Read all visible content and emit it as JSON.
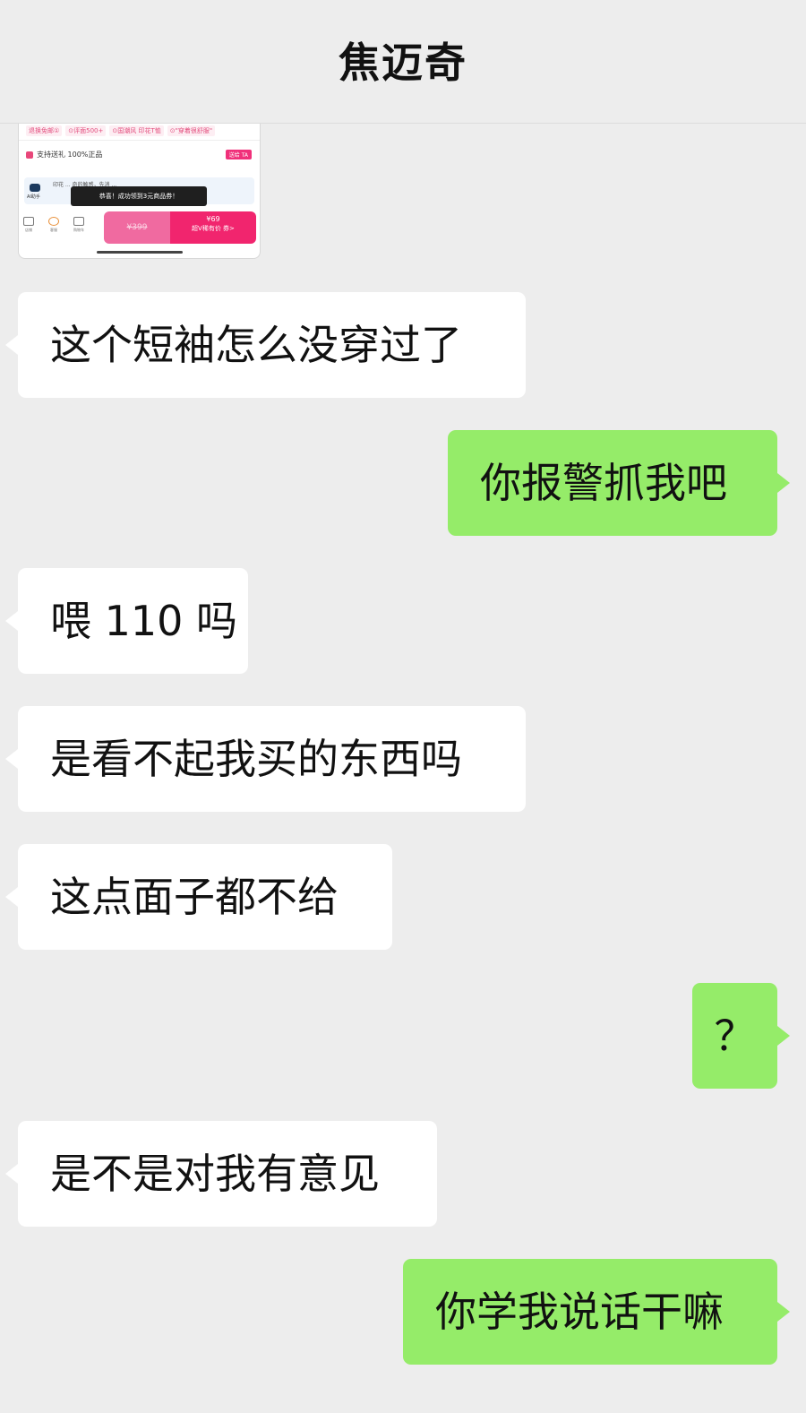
{
  "header": {
    "title": "焦迈奇"
  },
  "thumbnail": {
    "tags": [
      "退换免邮①",
      "⊙评面500+",
      "⊙国潮风 印花T恤",
      "⊙\"穿着很舒服\""
    ],
    "support_text": "支持送礼  100%正品",
    "send_label": "送给 TA",
    "ai_label": "AI助手",
    "ai_text": "印花 ... 奇的触感，先消 ...",
    "toast": "恭喜！成功领到3元商品券！",
    "bottom_icons": [
      "店铺",
      "客服",
      "购物车"
    ],
    "original_price": "¥399",
    "sale_price": "¥69",
    "sale_sub": "超V稀有价 券>"
  },
  "messages": [
    {
      "side": "left",
      "text": "这个短袖怎么没穿过了"
    },
    {
      "side": "right",
      "text": "你报警抓我吧"
    },
    {
      "side": "left",
      "text": "喂 110 吗"
    },
    {
      "side": "left",
      "text": "是看不起我买的东西吗"
    },
    {
      "side": "left",
      "text": "这点面子都不给"
    },
    {
      "side": "right",
      "text": "？"
    },
    {
      "side": "left",
      "text": "是不是对我有意见"
    },
    {
      "side": "right",
      "text": "你学我说话干嘛"
    }
  ],
  "colors": {
    "background": "#ededed",
    "incoming_bubble": "#ffffff",
    "outgoing_bubble": "#95ec69"
  }
}
